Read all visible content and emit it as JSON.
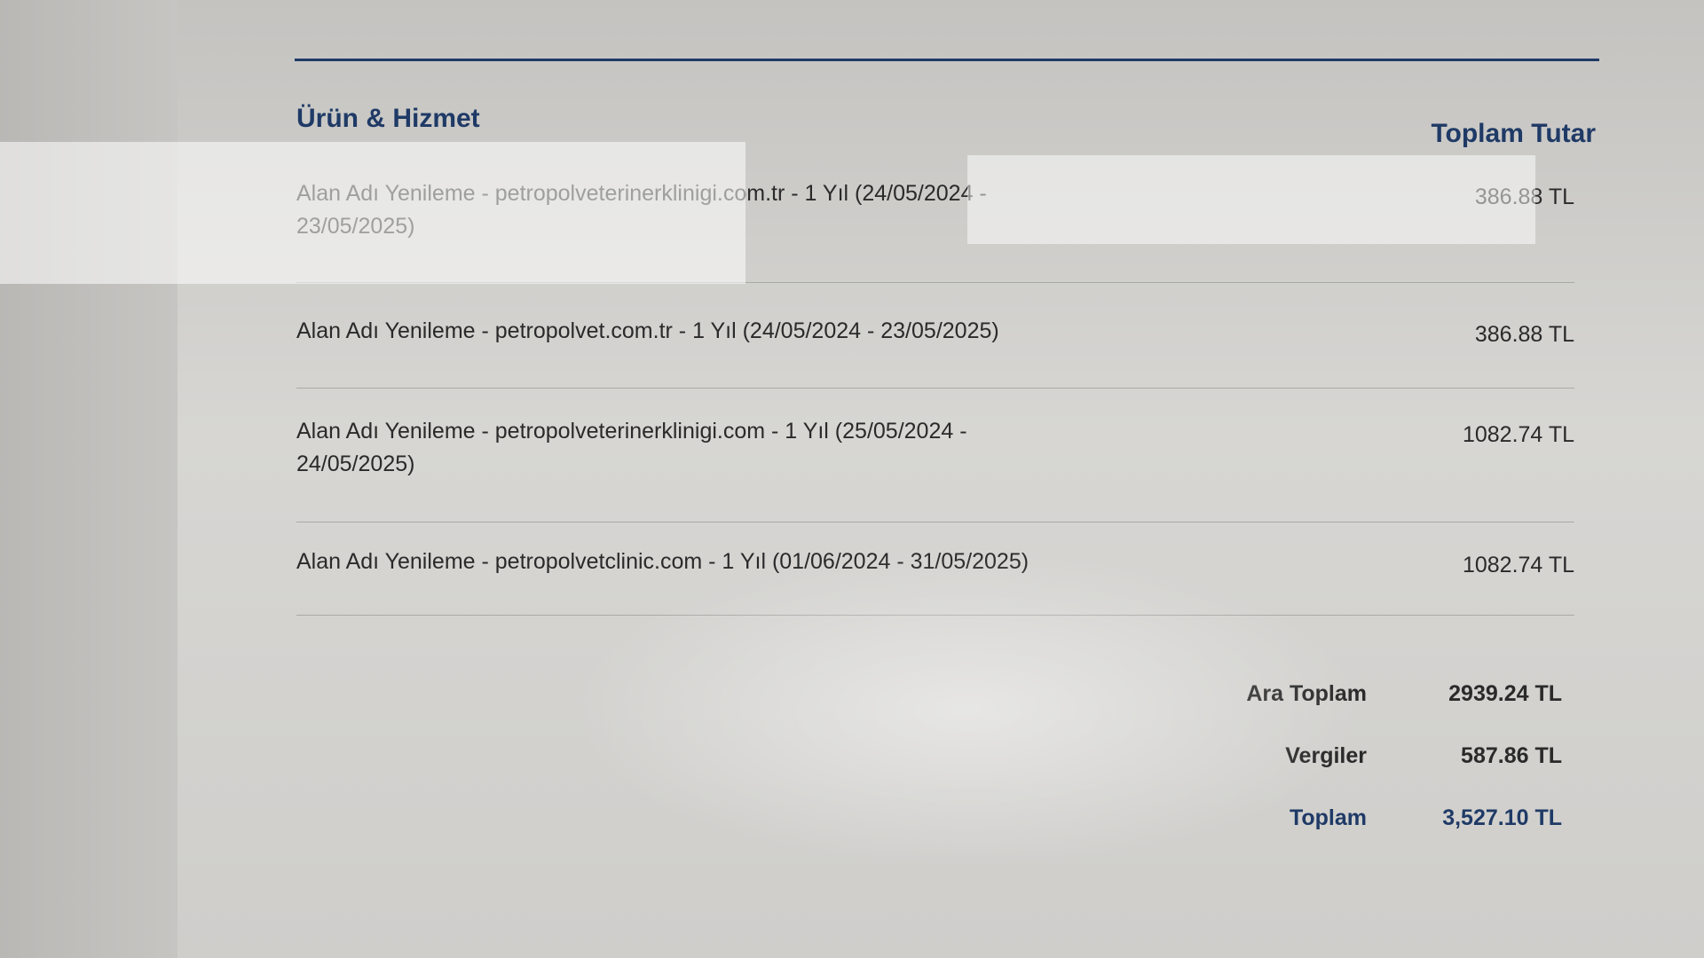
{
  "invoice": {
    "columns": {
      "item_header": "Ürün & Hizmet",
      "amount_header": "Toplam Tutar"
    },
    "items": [
      {
        "description": "Alan Adı Yenileme - petropolveterinerklinigi.com.tr - 1 Yıl (24/05/2024 - 23/05/2025)",
        "amount": "386.88 TL"
      },
      {
        "description": "Alan Adı Yenileme - petropolvet.com.tr - 1 Yıl (24/05/2024 - 23/05/2025)",
        "amount": "386.88 TL"
      },
      {
        "description": "Alan Adı Yenileme - petropolveterinerklinigi.com - 1 Yıl (25/05/2024 - 24/05/2025)",
        "amount": "1082.74 TL"
      },
      {
        "description": "Alan Adı Yenileme - petropolvetclinic.com - 1 Yıl (01/06/2024 - 31/05/2025)",
        "amount": "1082.74 TL"
      }
    ],
    "totals": {
      "subtotal_label": "Ara Toplam",
      "subtotal_value": "2939.24 TL",
      "tax_label": "Vergiler",
      "tax_value": "587.86 TL",
      "total_label": "Toplam",
      "total_value": "3,527.10 TL"
    }
  },
  "colors": {
    "accent": "#1f3a66",
    "text": "#2a2a2a",
    "divider": "#a9a9a6"
  }
}
